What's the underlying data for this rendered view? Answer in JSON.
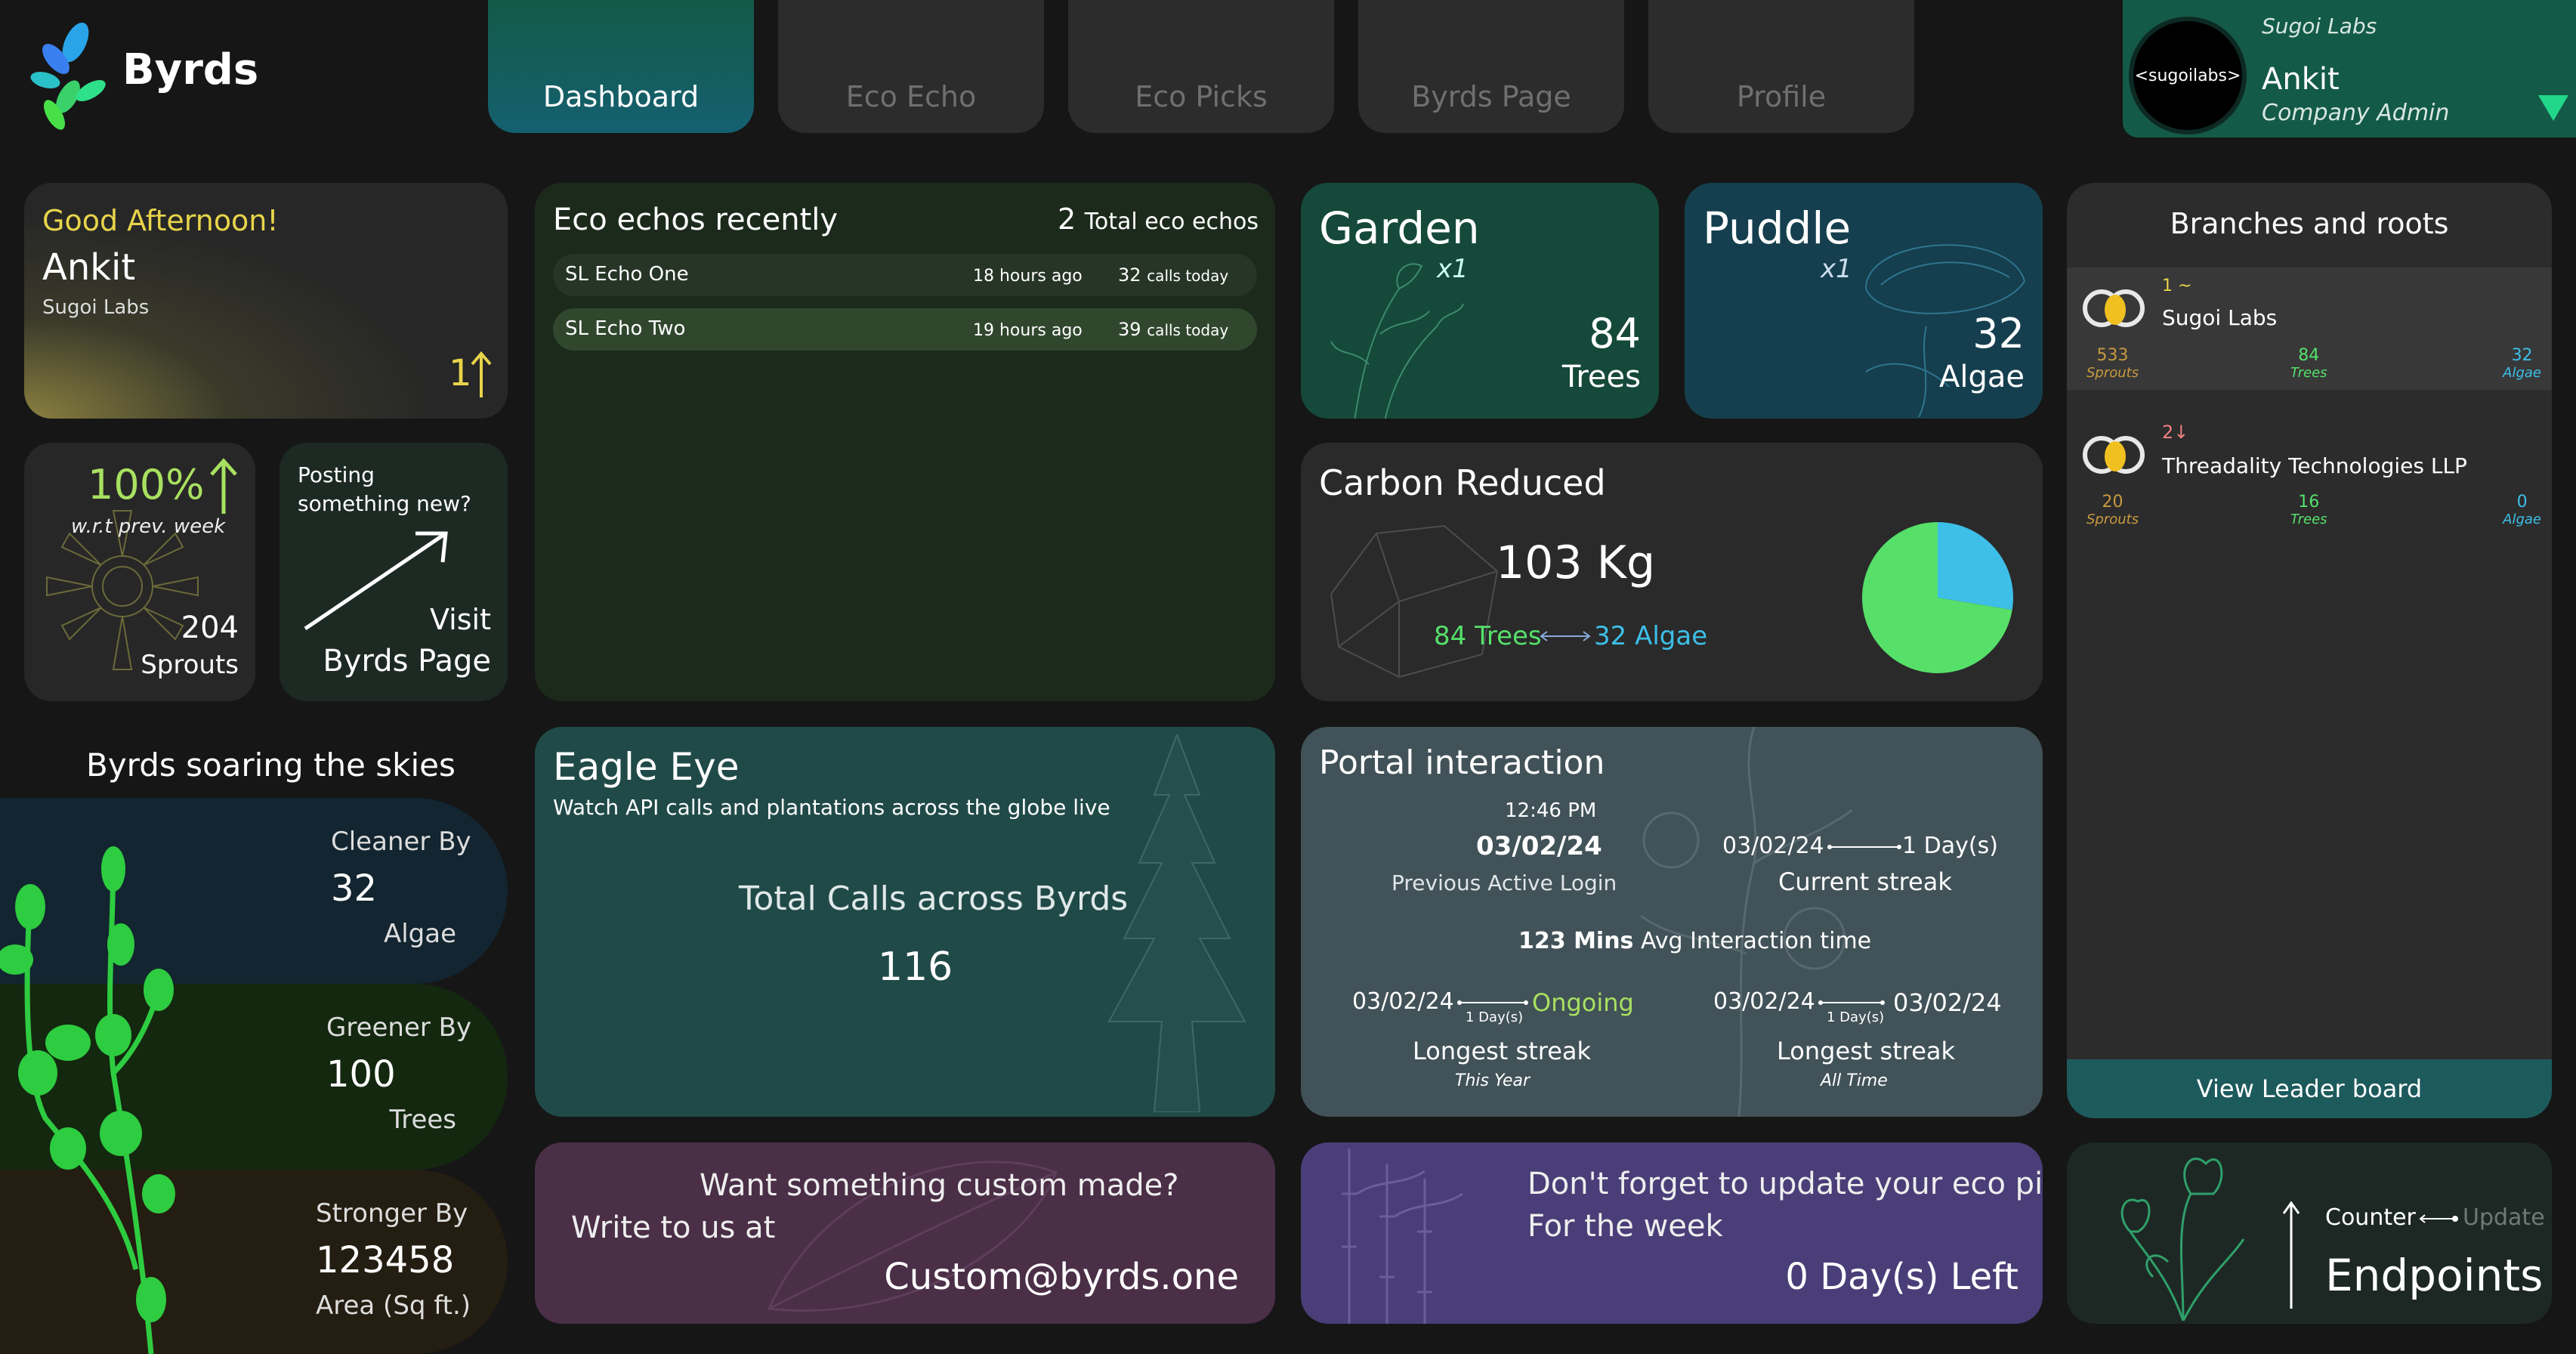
{
  "brand": {
    "name": "Byrds"
  },
  "nav": {
    "tabs": [
      {
        "label": "Dashboard"
      },
      {
        "label": "Eco Echo"
      },
      {
        "label": "Eco Picks"
      },
      {
        "label": "Byrds Page"
      },
      {
        "label": "Profile"
      }
    ]
  },
  "user": {
    "company": "Sugoi Labs",
    "name": "Ankit",
    "role": "Company Admin",
    "avatar_text": "<sugoilabs>"
  },
  "greeting": {
    "salutation": "Good Afternoon!",
    "name": "Ankit",
    "company": "Sugoi Labs",
    "rank": "1"
  },
  "sprouts": {
    "percent": "100%",
    "note": "w.r.t prev. week",
    "value": "204",
    "unit": "Sprouts"
  },
  "post": {
    "prompt": "Posting something new?",
    "cta_line1": "Visit",
    "cta_line2": "Byrds Page"
  },
  "echos": {
    "title": "Eco echos recently",
    "total": "2",
    "total_label": "Total eco echos",
    "items": [
      {
        "name": "SL Echo One",
        "time": "18 hours ago",
        "calls": "32",
        "calls_label": "calls today"
      },
      {
        "name": "SL Echo Two",
        "time": "19 hours ago",
        "calls": "39",
        "calls_label": "calls today"
      }
    ]
  },
  "garden": {
    "title": "Garden",
    "mult": "x1",
    "value": "84",
    "unit": "Trees"
  },
  "puddle": {
    "title": "Puddle",
    "mult": "x1",
    "value": "32",
    "unit": "Algae"
  },
  "carbon": {
    "title": "Carbon Reduced",
    "value": "103 Kg",
    "trees": "84 Trees",
    "algae": "32 Algae"
  },
  "branches": {
    "title": "Branches and roots",
    "rows": [
      {
        "rank": "1",
        "trend": "~",
        "name": "Sugoi Labs",
        "sprouts": "533",
        "trees": "84",
        "algae": "32"
      },
      {
        "rank": "2",
        "trend": "↓",
        "name": "Threadality Technologies LLP",
        "sprouts": "20",
        "trees": "16",
        "algae": "0"
      }
    ],
    "lbl_sprouts": "Sprouts",
    "lbl_trees": "Trees",
    "lbl_algae": "Algae",
    "button": "View Leader board"
  },
  "soaring": {
    "title": "Byrds soaring the skies",
    "items": [
      {
        "label": "Cleaner By",
        "value": "32",
        "unit": "Algae"
      },
      {
        "label": "Greener By",
        "value": "100",
        "unit": "Trees"
      },
      {
        "label": "Stronger By",
        "value": "123458",
        "unit": "Area (Sq ft.)"
      }
    ]
  },
  "eagle": {
    "title": "Eagle Eye",
    "subtitle": "Watch API calls and plantations across the globe live",
    "calls_label": "Total Calls across Byrds",
    "calls": "116"
  },
  "portal": {
    "title": "Portal interaction",
    "login_time": "12:46 PM",
    "login_date": "03/02/24",
    "login_label": "Previous Active Login",
    "cur_from": "03/02/24",
    "cur_days": "1 Day(s)",
    "cur_label": "Current streak",
    "avg": "123 Mins",
    "avg_label": "Avg Interaction time",
    "year_from": "03/02/24",
    "year_days": "1 Day(s)",
    "year_to": "Ongoing",
    "year_label": "Longest streak",
    "year_sub": "This Year",
    "all_from": "03/02/24",
    "all_days": "1 Day(s)",
    "all_to": "03/02/24",
    "all_label": "Longest streak",
    "all_sub": "All Time"
  },
  "custom": {
    "line1": "Want something custom made?",
    "line2": "Write to us at",
    "email": "Custom@byrds.one"
  },
  "picks": {
    "line1": "Don't forget to update your eco picks",
    "line2": "For the week",
    "left": "0 Day(s) Left"
  },
  "endpoints": {
    "counter": "Counter",
    "update": "Update",
    "title": "Endpoints"
  },
  "colors": {
    "bg": "#161616",
    "accent": "#56e06a",
    "algae": "#3dbfe8",
    "greeting": "#e8d44a"
  }
}
